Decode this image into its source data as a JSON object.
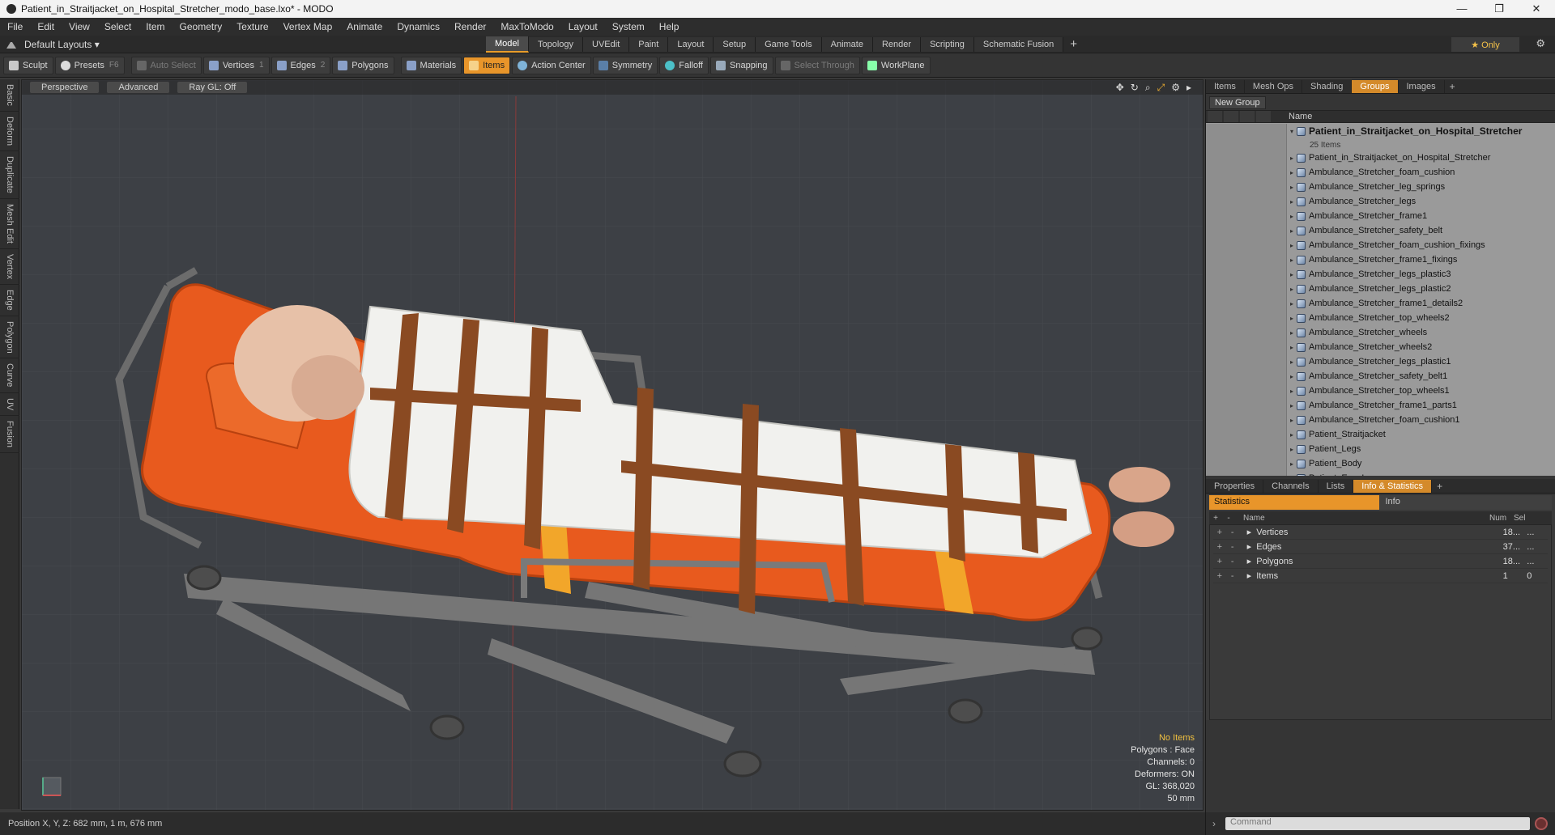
{
  "window": {
    "title": "Patient_in_Straitjacket_on_Hospital_Stretcher_modo_base.lxo* - MODO",
    "min": "—",
    "max": "❐",
    "close": "✕"
  },
  "menu": [
    "File",
    "Edit",
    "View",
    "Select",
    "Item",
    "Geometry",
    "Texture",
    "Vertex Map",
    "Animate",
    "Dynamics",
    "Render",
    "MaxToModo",
    "Layout",
    "System",
    "Help"
  ],
  "layouts": {
    "label": "Default Layouts ▾"
  },
  "main_tabs": [
    "Model",
    "Topology",
    "UVEdit",
    "Paint",
    "Layout",
    "Setup",
    "Game Tools",
    "Animate",
    "Render",
    "Scripting",
    "Schematic Fusion"
  ],
  "active_main_tab": "Model",
  "tab_plus": "+",
  "only_label": "★  Only",
  "toolbar": {
    "sculpt": "Sculpt",
    "presets": "Presets",
    "presets_key": "F6",
    "auto_select": "Auto Select",
    "vertices": "Vertices",
    "vertices_key": "1",
    "edges": "Edges",
    "edges_key": "2",
    "polygons": "Polygons",
    "materials": "Materials",
    "items": "Items",
    "action_center": "Action Center",
    "symmetry": "Symmetry",
    "falloff": "Falloff",
    "snapping": "Snapping",
    "select_through": "Select Through",
    "workplane": "WorkPlane"
  },
  "left_strip": [
    "Basic",
    "Deform",
    "Duplicate",
    "Mesh Edit",
    "Vertex",
    "Edge",
    "Polygon",
    "Curve",
    "UV",
    "Fusion"
  ],
  "viewport": {
    "view_mode": "Perspective",
    "shading": "Advanced",
    "raygl": "Ray GL: Off",
    "hud": {
      "items": "No Items",
      "polygons": "Polygons : Face",
      "channels": "Channels: 0",
      "deformers": "Deformers: ON",
      "gl": "GL: 368,020",
      "distance": "50 mm"
    }
  },
  "status": {
    "position": "Position X, Y, Z:  682 mm, 1 m, 676 mm"
  },
  "right_top_tabs": [
    "Items",
    "Mesh Ops",
    "Shading",
    "Groups",
    "Images"
  ],
  "right_top_active": "Groups",
  "new_group": "New Group",
  "tree_header": {
    "name": "Name"
  },
  "group": {
    "name": "Patient_in_Straitjacket_on_Hospital_Stretcher",
    "count": "25 Items"
  },
  "tree_items": [
    "Patient_in_Straitjacket_on_Hospital_Stretcher",
    "Ambulance_Stretcher_foam_cushion",
    "Ambulance_Stretcher_leg_springs",
    "Ambulance_Stretcher_legs",
    "Ambulance_Stretcher_frame1",
    "Ambulance_Stretcher_safety_belt",
    "Ambulance_Stretcher_foam_cushion_fixings",
    "Ambulance_Stretcher_frame1_fixings",
    "Ambulance_Stretcher_legs_plastic3",
    "Ambulance_Stretcher_legs_plastic2",
    "Ambulance_Stretcher_frame1_details2",
    "Ambulance_Stretcher_top_wheels2",
    "Ambulance_Stretcher_wheels",
    "Ambulance_Stretcher_wheels2",
    "Ambulance_Stretcher_legs_plastic1",
    "Ambulance_Stretcher_safety_belt1",
    "Ambulance_Stretcher_top_wheels1",
    "Ambulance_Stretcher_frame1_parts1",
    "Ambulance_Stretcher_foam_cushion1",
    "Patient_Straitjacket",
    "Patient_Legs",
    "Patient_Body",
    "Patient_Eye_L"
  ],
  "right_bottom_tabs": [
    "Properties",
    "Channels",
    "Lists",
    "Info & Statistics"
  ],
  "right_bottom_active": "Info & Statistics",
  "stats_tabs": {
    "statistics": "Statistics",
    "info": "Info"
  },
  "stats_header": {
    "name": "Name",
    "num": "Num",
    "sel": "Sel"
  },
  "stats_rows": [
    {
      "name": "Vertices",
      "num": "18...",
      "sel": "..."
    },
    {
      "name": "Edges",
      "num": "37...",
      "sel": "..."
    },
    {
      "name": "Polygons",
      "num": "18...",
      "sel": "..."
    },
    {
      "name": "Items",
      "num": "1",
      "sel": "0"
    }
  ],
  "command_placeholder": "Command",
  "colors": {
    "accent": "#e8952a",
    "viewport_bg": "#3d4045",
    "stretcher_orange": "#e85a1e",
    "belt_yellow": "#f2a62a",
    "strap_brown": "#8a4a22"
  }
}
